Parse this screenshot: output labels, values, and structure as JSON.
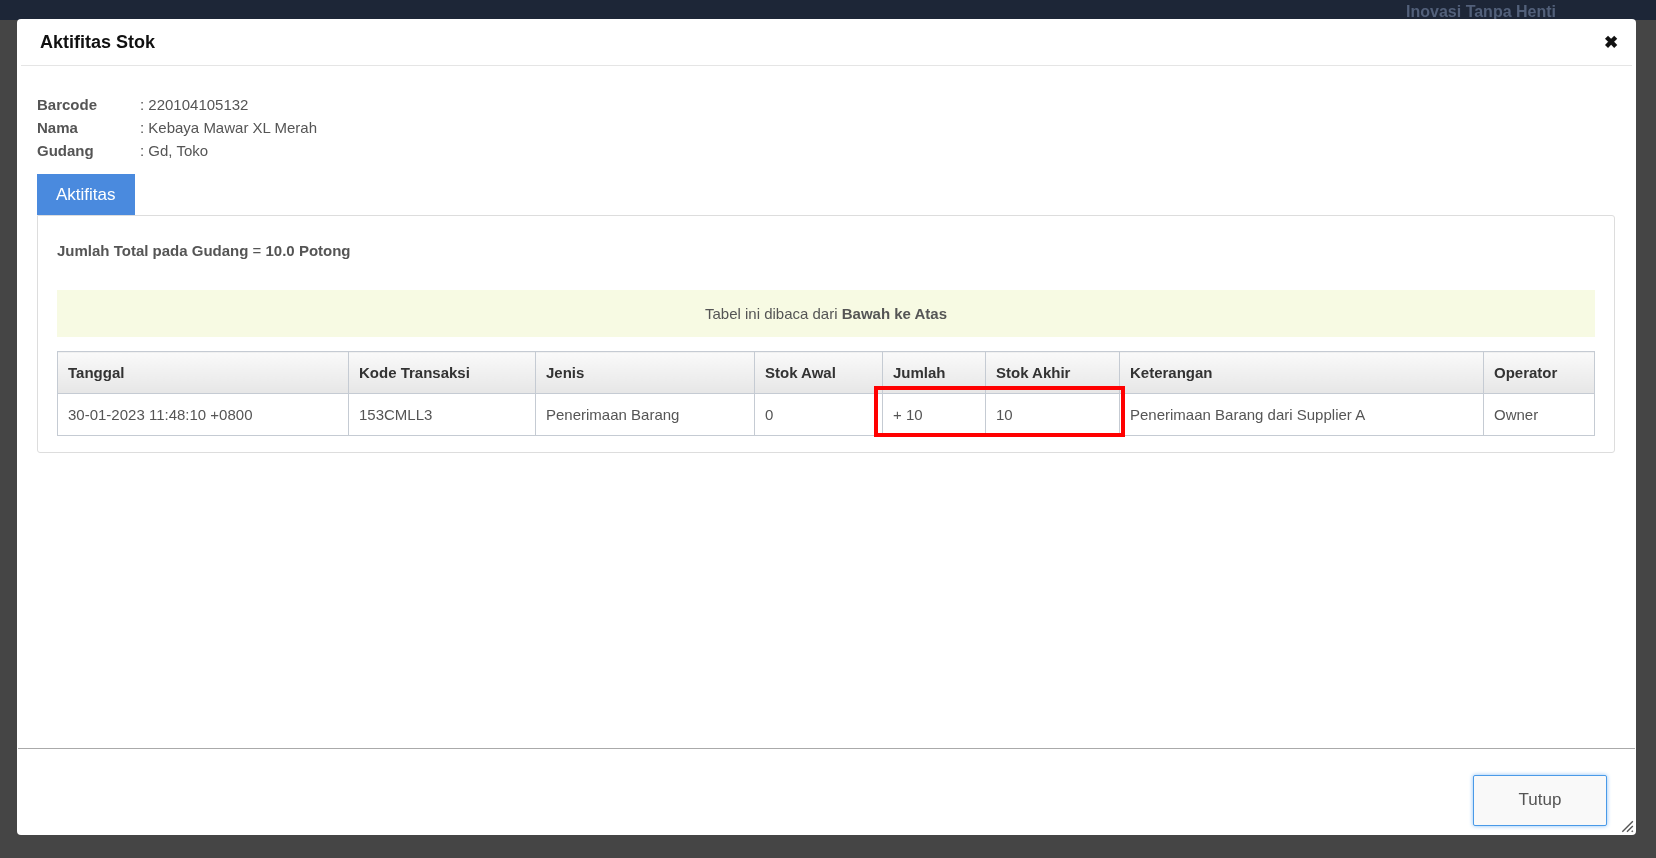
{
  "background": {
    "brand_tagline": "Inovasi Tanpa Henti"
  },
  "dialog": {
    "title": "Aktifitas Stok",
    "close_icon": "✖",
    "info": [
      {
        "label": "Barcode",
        "value": ": 220104105132"
      },
      {
        "label": "Nama",
        "value": ": Kebaya Mawar XL Merah"
      },
      {
        "label": "Gudang",
        "value": ": Gd, Toko"
      }
    ],
    "tabs": [
      {
        "label": "Aktifitas",
        "selected": true
      }
    ],
    "total": "**Jumlah Total pada Gudang** = **10.0 Potong**",
    "notice": "Tabel ini dibaca dari **Bawah ke Atas**",
    "table": {
      "columns": [
        "Tanggal",
        "Kode Transaksi",
        "Jenis",
        "Stok Awal",
        "Jumlah",
        "Stok Akhir",
        "Keterangan",
        "Operator"
      ],
      "rows": [
        {
          "cells": [
            {
              "text": "30-01-2023 11:48:10 +0800",
              "highlighted": false
            },
            {
              "text": "153CMLL3",
              "highlighted": false
            },
            {
              "text": "Penerimaan Barang",
              "highlighted": false
            },
            {
              "text": "0",
              "highlighted": false
            },
            {
              "text": "+ 10",
              "highlighted": true
            },
            {
              "text": "10",
              "highlighted": true
            },
            {
              "text": "Penerimaan Barang dari Supplier A",
              "highlighted": false
            },
            {
              "text": "Owner",
              "highlighted": false
            }
          ]
        }
      ]
    },
    "buttons": [
      {
        "label": "Tutup",
        "focused": true
      }
    ]
  }
}
